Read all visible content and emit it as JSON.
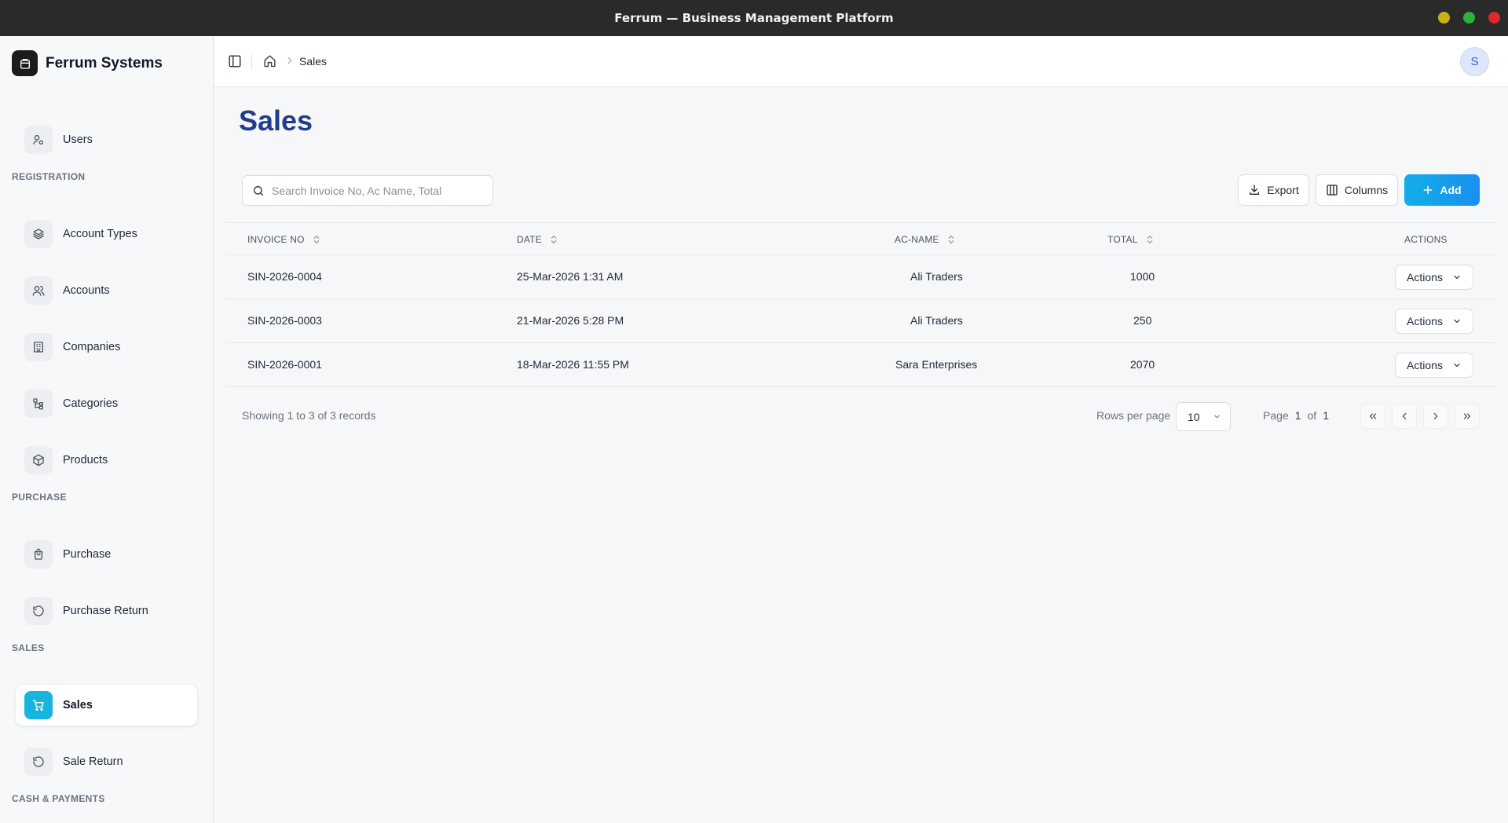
{
  "window": {
    "title": "Ferrum — Business Management Platform"
  },
  "brand": {
    "name": "Ferrum Systems"
  },
  "sidebar": {
    "sections": {
      "registration": "REGISTRATION",
      "purchase": "PURCHASE",
      "sales": "SALES",
      "cash": "CASH & PAYMENTS"
    },
    "items": {
      "users": {
        "label": "Users",
        "icon": "users-icon"
      },
      "account_types": {
        "label": "Account Types",
        "icon": "layers-icon"
      },
      "accounts": {
        "label": "Accounts",
        "icon": "accounts-icon"
      },
      "companies": {
        "label": "Companies",
        "icon": "building-icon"
      },
      "categories": {
        "label": "Categories",
        "icon": "tree-icon"
      },
      "products": {
        "label": "Products",
        "icon": "package-icon"
      },
      "purchase": {
        "label": "Purchase",
        "icon": "shopping-bag-icon"
      },
      "purchase_return": {
        "label": "Purchase Return",
        "icon": "rotate-ccw-icon"
      },
      "sales": {
        "label": "Sales",
        "icon": "cart-icon",
        "active": true
      },
      "sale_return": {
        "label": "Sale Return",
        "icon": "rotate-ccw-icon"
      }
    }
  },
  "header": {
    "breadcrumb_current": "Sales",
    "avatar_initial": "S"
  },
  "main": {
    "title": "Sales",
    "search_placeholder": "Search Invoice No, Ac Name, Total",
    "search_value": "",
    "export_label": "Export",
    "columns_label": "Columns",
    "add_label": "Add"
  },
  "table": {
    "headers": {
      "invoice": "INVOICE NO",
      "date": "DATE",
      "acname": "AC-NAME",
      "total": "TOTAL",
      "actions": "ACTIONS"
    },
    "rows": [
      {
        "invoice": "SIN-2026-0004",
        "date": "25-Mar-2026 1:31 AM",
        "acname": "Ali Traders",
        "total": "1000",
        "action": "Actions"
      },
      {
        "invoice": "SIN-2026-0003",
        "date": "21-Mar-2026 5:28 PM",
        "acname": "Ali Traders",
        "total": "250",
        "action": "Actions"
      },
      {
        "invoice": "SIN-2026-0001",
        "date": "18-Mar-2026 11:55 PM",
        "acname": "Sara Enterprises",
        "total": "2070",
        "action": "Actions"
      }
    ]
  },
  "pagination": {
    "info": "Showing 1 to 3 of 3 records",
    "rows_per_page_label": "Rows per page",
    "rows_per_page_value": "10",
    "page_label": "Page",
    "current_page": "1",
    "of_label": "of",
    "total_pages": "1"
  },
  "colors": {
    "accent": "#17b5de",
    "title": "#1f3d8a",
    "add_button": "#169fe6"
  }
}
